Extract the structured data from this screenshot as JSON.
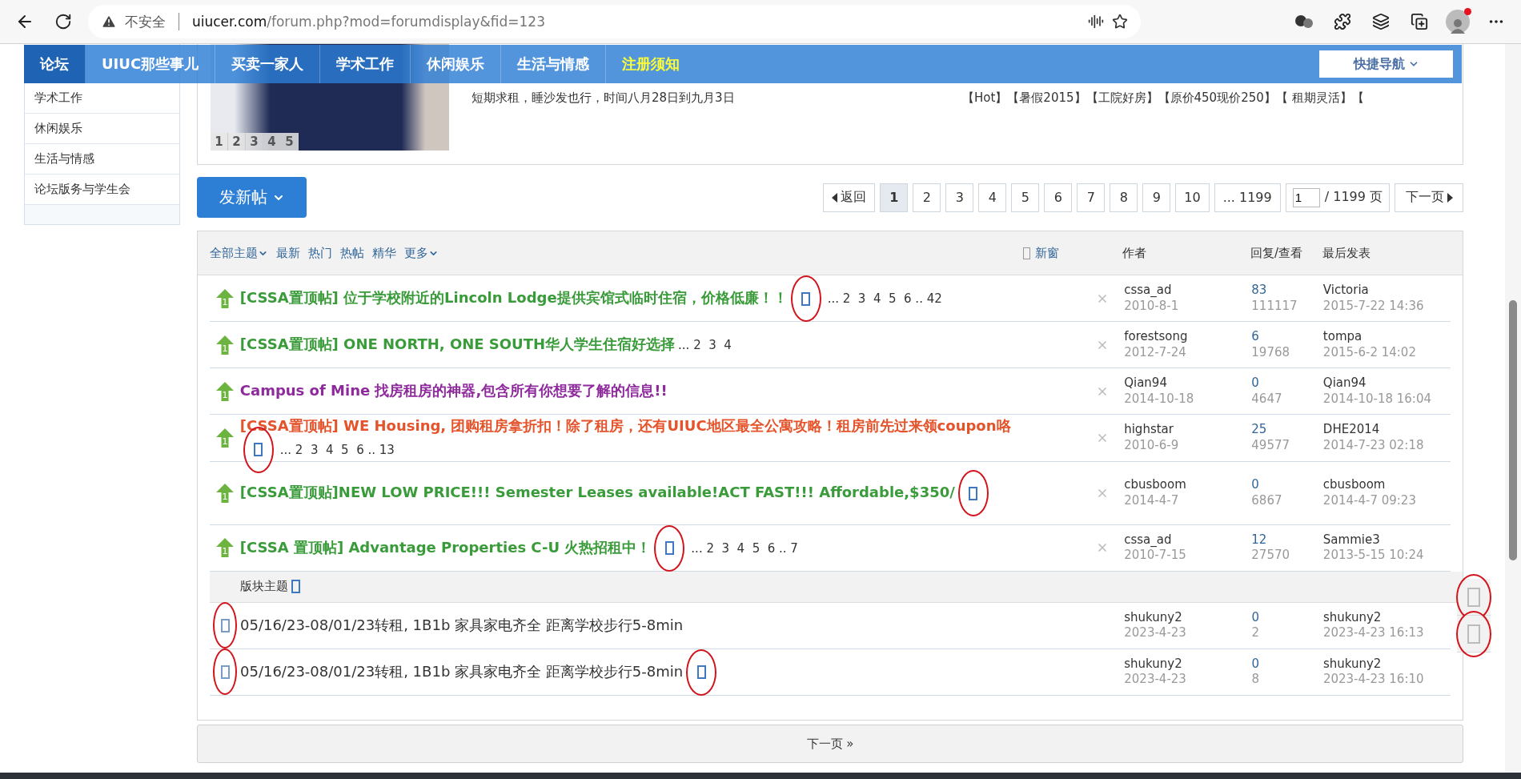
{
  "browser": {
    "security": "不安全",
    "url_host": "uiucer.com",
    "url_path": "/forum.php?mod=forumdisplay&fid=123"
  },
  "nav": {
    "items": [
      {
        "label": "论坛",
        "selected": true,
        "highlighted": false
      },
      {
        "label": "UIUC那些事儿",
        "selected": false,
        "highlighted": false
      },
      {
        "label": "买卖一家人",
        "selected": false,
        "highlighted": false
      },
      {
        "label": "学术工作",
        "selected": false,
        "highlighted": false
      },
      {
        "label": "休闲娱乐",
        "selected": false,
        "highlighted": false
      },
      {
        "label": "生活与情感",
        "selected": false,
        "highlighted": false
      },
      {
        "label": "注册须知",
        "selected": false,
        "highlighted": true
      }
    ],
    "quick_nav": "快捷导航"
  },
  "sidebar": {
    "items": [
      "学术工作",
      "休闲娱乐",
      "生活与情感",
      "论坛版务与学生会"
    ]
  },
  "slideshow": {
    "numbers": [
      "1",
      "2",
      "3",
      "4",
      "5"
    ],
    "line": "短期求租，睡沙发也行，时间八月28日到九月3日",
    "tags": "【Hot】【暑假2015】【工院好房】【原价450现价250】【 租期灵活】【"
  },
  "toolbar": {
    "new_post": "发新帖",
    "back": "返回",
    "pages": [
      {
        "label": "1",
        "selected": true
      },
      {
        "label": "2",
        "selected": false
      },
      {
        "label": "3",
        "selected": false
      },
      {
        "label": "4",
        "selected": false
      },
      {
        "label": "5",
        "selected": false
      },
      {
        "label": "6",
        "selected": false
      },
      {
        "label": "7",
        "selected": false
      },
      {
        "label": "8",
        "selected": false
      },
      {
        "label": "9",
        "selected": false
      },
      {
        "label": "10",
        "selected": false
      },
      {
        "label": "... 1199",
        "selected": false
      }
    ],
    "page_input": "1",
    "total": "/ 1199 页",
    "next": "下一页"
  },
  "thread_list": {
    "filters": [
      {
        "label": "全部主题",
        "dropdown": true
      },
      {
        "label": "最新",
        "dropdown": false
      },
      {
        "label": "热门",
        "dropdown": false
      },
      {
        "label": "热帖",
        "dropdown": false
      },
      {
        "label": "精华",
        "dropdown": false
      },
      {
        "label": "更多",
        "dropdown": true
      }
    ],
    "new_window": "新窗",
    "columns": [
      "作者",
      "回复/查看",
      "最后发表"
    ],
    "threads": [
      {
        "kind": "sticky",
        "badge": "1",
        "title": "[CSSA置顶帖] 位于学校附近的Lincoln Lodge提供宾馆式临时住宿，价格低廉！！",
        "color": "#3a9b3a",
        "tail_icon": {
          "circled": true
        },
        "pages": "... 2  3  4  5  6 .. 42",
        "author": "cssa_ad",
        "date": "2010-8-1",
        "replies": "83",
        "views": "111117",
        "last_author": "Victoria",
        "last_time": "2015-7-22 14:36"
      },
      {
        "kind": "sticky",
        "badge": "1",
        "title": "[CSSA置顶帖] ONE NORTH, ONE SOUTH华人学生住宿好选择",
        "color": "#3a9b3a",
        "pages": "... 2  3  4",
        "author": "forestsong",
        "date": "2012-7-24",
        "replies": "6",
        "views": "19768",
        "last_author": "tompa",
        "last_time": "2015-6-2 14:02"
      },
      {
        "kind": "sticky",
        "badge": "1",
        "title": "Campus of Mine 找房租房的神器,包含所有你想要了解的信息!!",
        "color": "#8e2a9c",
        "author": "Qian94",
        "date": "2014-10-18",
        "replies": "0",
        "views": "4647",
        "last_author": "Qian94",
        "last_time": "2014-10-18 16:04"
      },
      {
        "kind": "sticky",
        "badge": "1",
        "title": "[CSSA置顶帖] WE Housing, 团购租房拿折扣！除了租房，还有UIUC地区最全公寓攻略！租房前先过来领coupon咯",
        "color": "#e5532b",
        "tail_icon": {
          "circled": true
        },
        "pages": "... 2  3  4  5  6 .. 13",
        "author": "highstar",
        "date": "2010-6-9",
        "replies": "25",
        "views": "49577",
        "last_author": "DHE2014",
        "last_time": "2014-7-23 02:18"
      },
      {
        "kind": "sticky",
        "badge": "1",
        "title": "[CSSA置顶贴]NEW LOW PRICE!!! Semester Leases available!ACT FAST!!! Affordable,$350/",
        "color": "#3a9b3a",
        "tail_icon": {
          "circled": true
        },
        "author": "cbusboom",
        "date": "2014-4-7",
        "replies": "0",
        "views": "6867",
        "last_author": "cbusboom",
        "last_time": "2014-4-7 09:23"
      },
      {
        "kind": "sticky",
        "badge": "1",
        "title": "[CSSA 置顶帖] Advantage Properties C-U 火热招租中！",
        "color": "#3a9b3a",
        "tail_icon": {
          "circled": true
        },
        "pages": "... 2  3  4  5  6 .. 7",
        "author": "cssa_ad",
        "date": "2010-7-15",
        "replies": "12",
        "views": "27570",
        "last_author": "Sammie3",
        "last_time": "2013-5-15 10:24"
      },
      {
        "kind": "section",
        "title": "版块主题"
      },
      {
        "kind": "normal",
        "lead_circled": true,
        "title": "05/16/23-08/01/23转租, 1B1b 家具家电齐全 距离学校步行5-8min",
        "color": "#333333",
        "author": "shukuny2",
        "date": "2023-4-23",
        "replies": "0",
        "views": "2",
        "last_author": "shukuny2",
        "last_time": "2023-4-23 16:13"
      },
      {
        "kind": "normal",
        "lead_circled": true,
        "title": "05/16/23-08/01/23转租, 1B1b 家具家电齐全 距离学校步行5-8min",
        "color": "#333333",
        "tail_icon": {
          "circled": true
        },
        "author": "shukuny2",
        "date": "2023-4-23",
        "replies": "0",
        "views": "8",
        "last_author": "shukuny2",
        "last_time": "2023-4-23 16:10"
      }
    ]
  },
  "next_page": "下一页 »",
  "side_buttons": [
    {
      "circled": true
    },
    {
      "circled": true
    }
  ]
}
